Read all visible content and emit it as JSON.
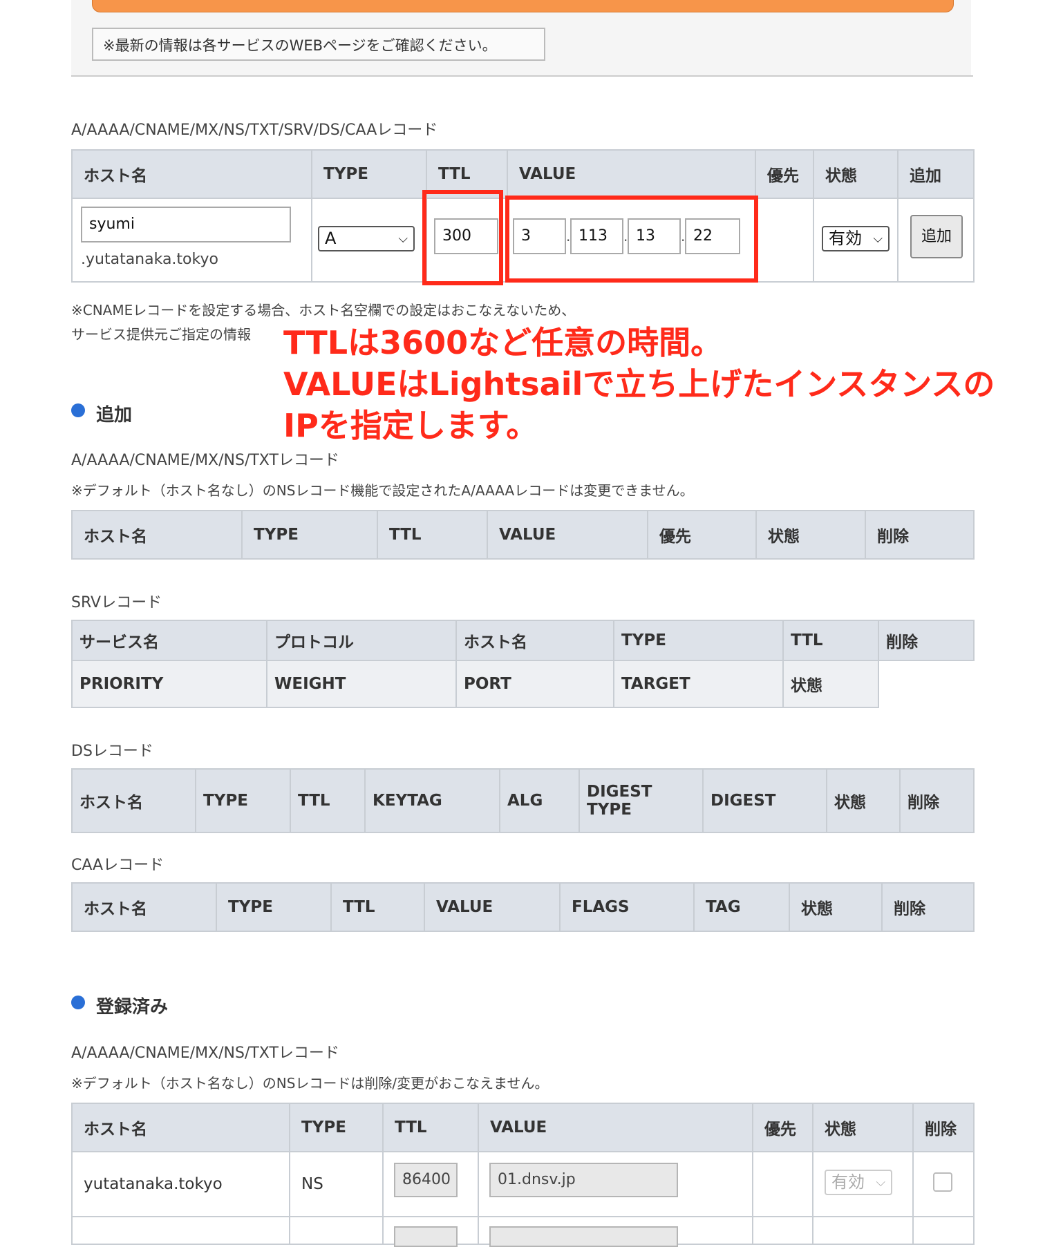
{
  "notice": "※最新の情報は各サービスのWEBページをご確認ください。",
  "add_form": {
    "caption": "A/AAAA/CNAME/MX/NS/TXT/SRV/DS/CAAレコード",
    "headers": [
      "ホスト名",
      "TYPE",
      "TTL",
      "VALUE",
      "優先",
      "状態",
      "追加"
    ],
    "host_value": "syumi",
    "domain_suffix": ".yutatanaka.tokyo",
    "type_value": "A",
    "ttl_value": "300",
    "ip1": "3",
    "ip2": "113",
    "ip3": "13",
    "ip4": "22",
    "status_value": "有効",
    "add_button": "追加",
    "note1": "※CNAMEレコードを設定する場合、ホスト名空欄での設定はおこなえないため、",
    "note2": "サービス提供元ご指定の情報"
  },
  "annotation": {
    "line1": "TTLは3600など任意の時間。",
    "line2": "VALUEはLightsailで立ち上げたインスタンスの",
    "line3": "IPを指定します。",
    "color": "#ff2a1a"
  },
  "added": {
    "title": "追加",
    "caption": "A/AAAA/CNAME/MX/NS/TXTレコード",
    "note": "※デフォルト（ホスト名なし）のNSレコード機能で設定されたA/AAAAレコードは変更できません。",
    "headers": [
      "ホスト名",
      "TYPE",
      "TTL",
      "VALUE",
      "優先",
      "状態",
      "削除"
    ],
    "srv_caption": "SRVレコード",
    "srv_row1": [
      "サービス名",
      "プロトコル",
      "ホスト名",
      "TYPE",
      "TTL",
      "削除"
    ],
    "srv_row2": [
      "PRIORITY",
      "WEIGHT",
      "PORT",
      "TARGET",
      "状態"
    ],
    "ds_caption": "DSレコード",
    "ds_headers": [
      "ホスト名",
      "TYPE",
      "TTL",
      "KEYTAG",
      "ALG",
      "DIGEST TYPE",
      "DIGEST",
      "状態",
      "削除"
    ],
    "caa_caption": "CAAレコード",
    "caa_headers": [
      "ホスト名",
      "TYPE",
      "TTL",
      "VALUE",
      "FLAGS",
      "TAG",
      "状態",
      "削除"
    ]
  },
  "registered": {
    "title": "登録済み",
    "caption": "A/AAAA/CNAME/MX/NS/TXTレコード",
    "note": "※デフォルト（ホスト名なし）のNSレコードは削除/変更がおこなえません。",
    "headers": [
      "ホスト名",
      "TYPE",
      "TTL",
      "VALUE",
      "優先",
      "状態",
      "削除"
    ],
    "row": {
      "host": "yutatanaka.tokyo",
      "type": "NS",
      "ttl": "86400",
      "value": "01.dnsv.jp",
      "status": "有効"
    }
  }
}
